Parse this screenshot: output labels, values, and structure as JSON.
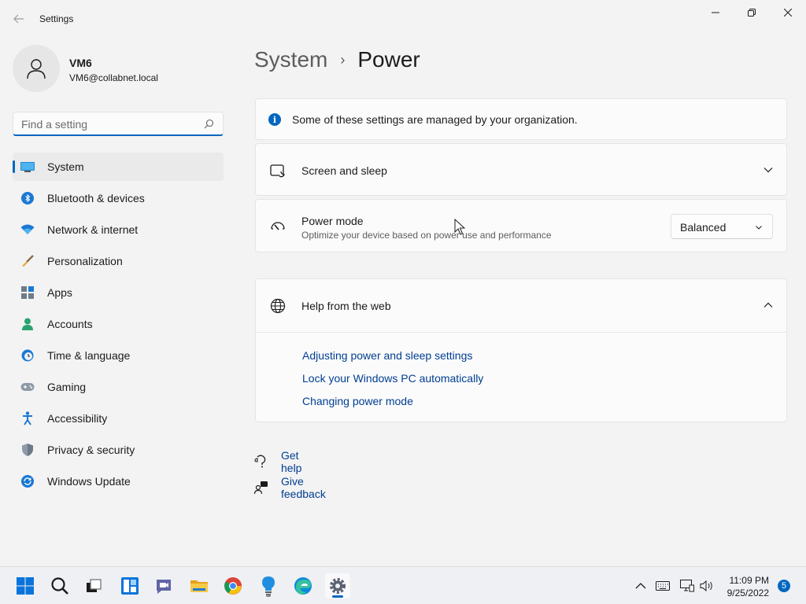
{
  "window": {
    "title": "Settings",
    "controls": {
      "minimize": "minimize-icon",
      "maximize": "restore-icon",
      "close": "close-icon"
    }
  },
  "user": {
    "name": "VM6",
    "email": "VM6@collabnet.local"
  },
  "search": {
    "placeholder": "Find a setting"
  },
  "sidebar": {
    "items": [
      {
        "label": "System",
        "icon": "system-icon",
        "active": true
      },
      {
        "label": "Bluetooth & devices",
        "icon": "bluetooth-icon"
      },
      {
        "label": "Network & internet",
        "icon": "wifi-icon"
      },
      {
        "label": "Personalization",
        "icon": "brush-icon"
      },
      {
        "label": "Apps",
        "icon": "apps-icon"
      },
      {
        "label": "Accounts",
        "icon": "accounts-icon"
      },
      {
        "label": "Time & language",
        "icon": "clock-globe-icon"
      },
      {
        "label": "Gaming",
        "icon": "gamepad-icon"
      },
      {
        "label": "Accessibility",
        "icon": "accessibility-icon"
      },
      {
        "label": "Privacy & security",
        "icon": "shield-icon"
      },
      {
        "label": "Windows Update",
        "icon": "update-icon"
      }
    ]
  },
  "breadcrumb": {
    "parent": "System",
    "separator": "›",
    "current": "Power"
  },
  "info": {
    "text": "Some of these settings are managed by your organization."
  },
  "screen_sleep": {
    "title": "Screen and sleep"
  },
  "power_mode": {
    "title": "Power mode",
    "description": "Optimize your device based on power use and performance",
    "selected": "Balanced"
  },
  "help": {
    "title": "Help from the web",
    "links": [
      "Adjusting power and sleep settings",
      "Lock your Windows PC automatically",
      "Changing power mode"
    ]
  },
  "footer": {
    "get_help": "Get help",
    "give_feedback": "Give feedback"
  },
  "taskbar": {
    "time": "11:09 PM",
    "date": "9/25/2022",
    "notification_count": "5"
  },
  "colors": {
    "accent": "#0067c0",
    "link": "#003e92",
    "background": "#f3f3f3",
    "card": "#fbfbfb"
  }
}
